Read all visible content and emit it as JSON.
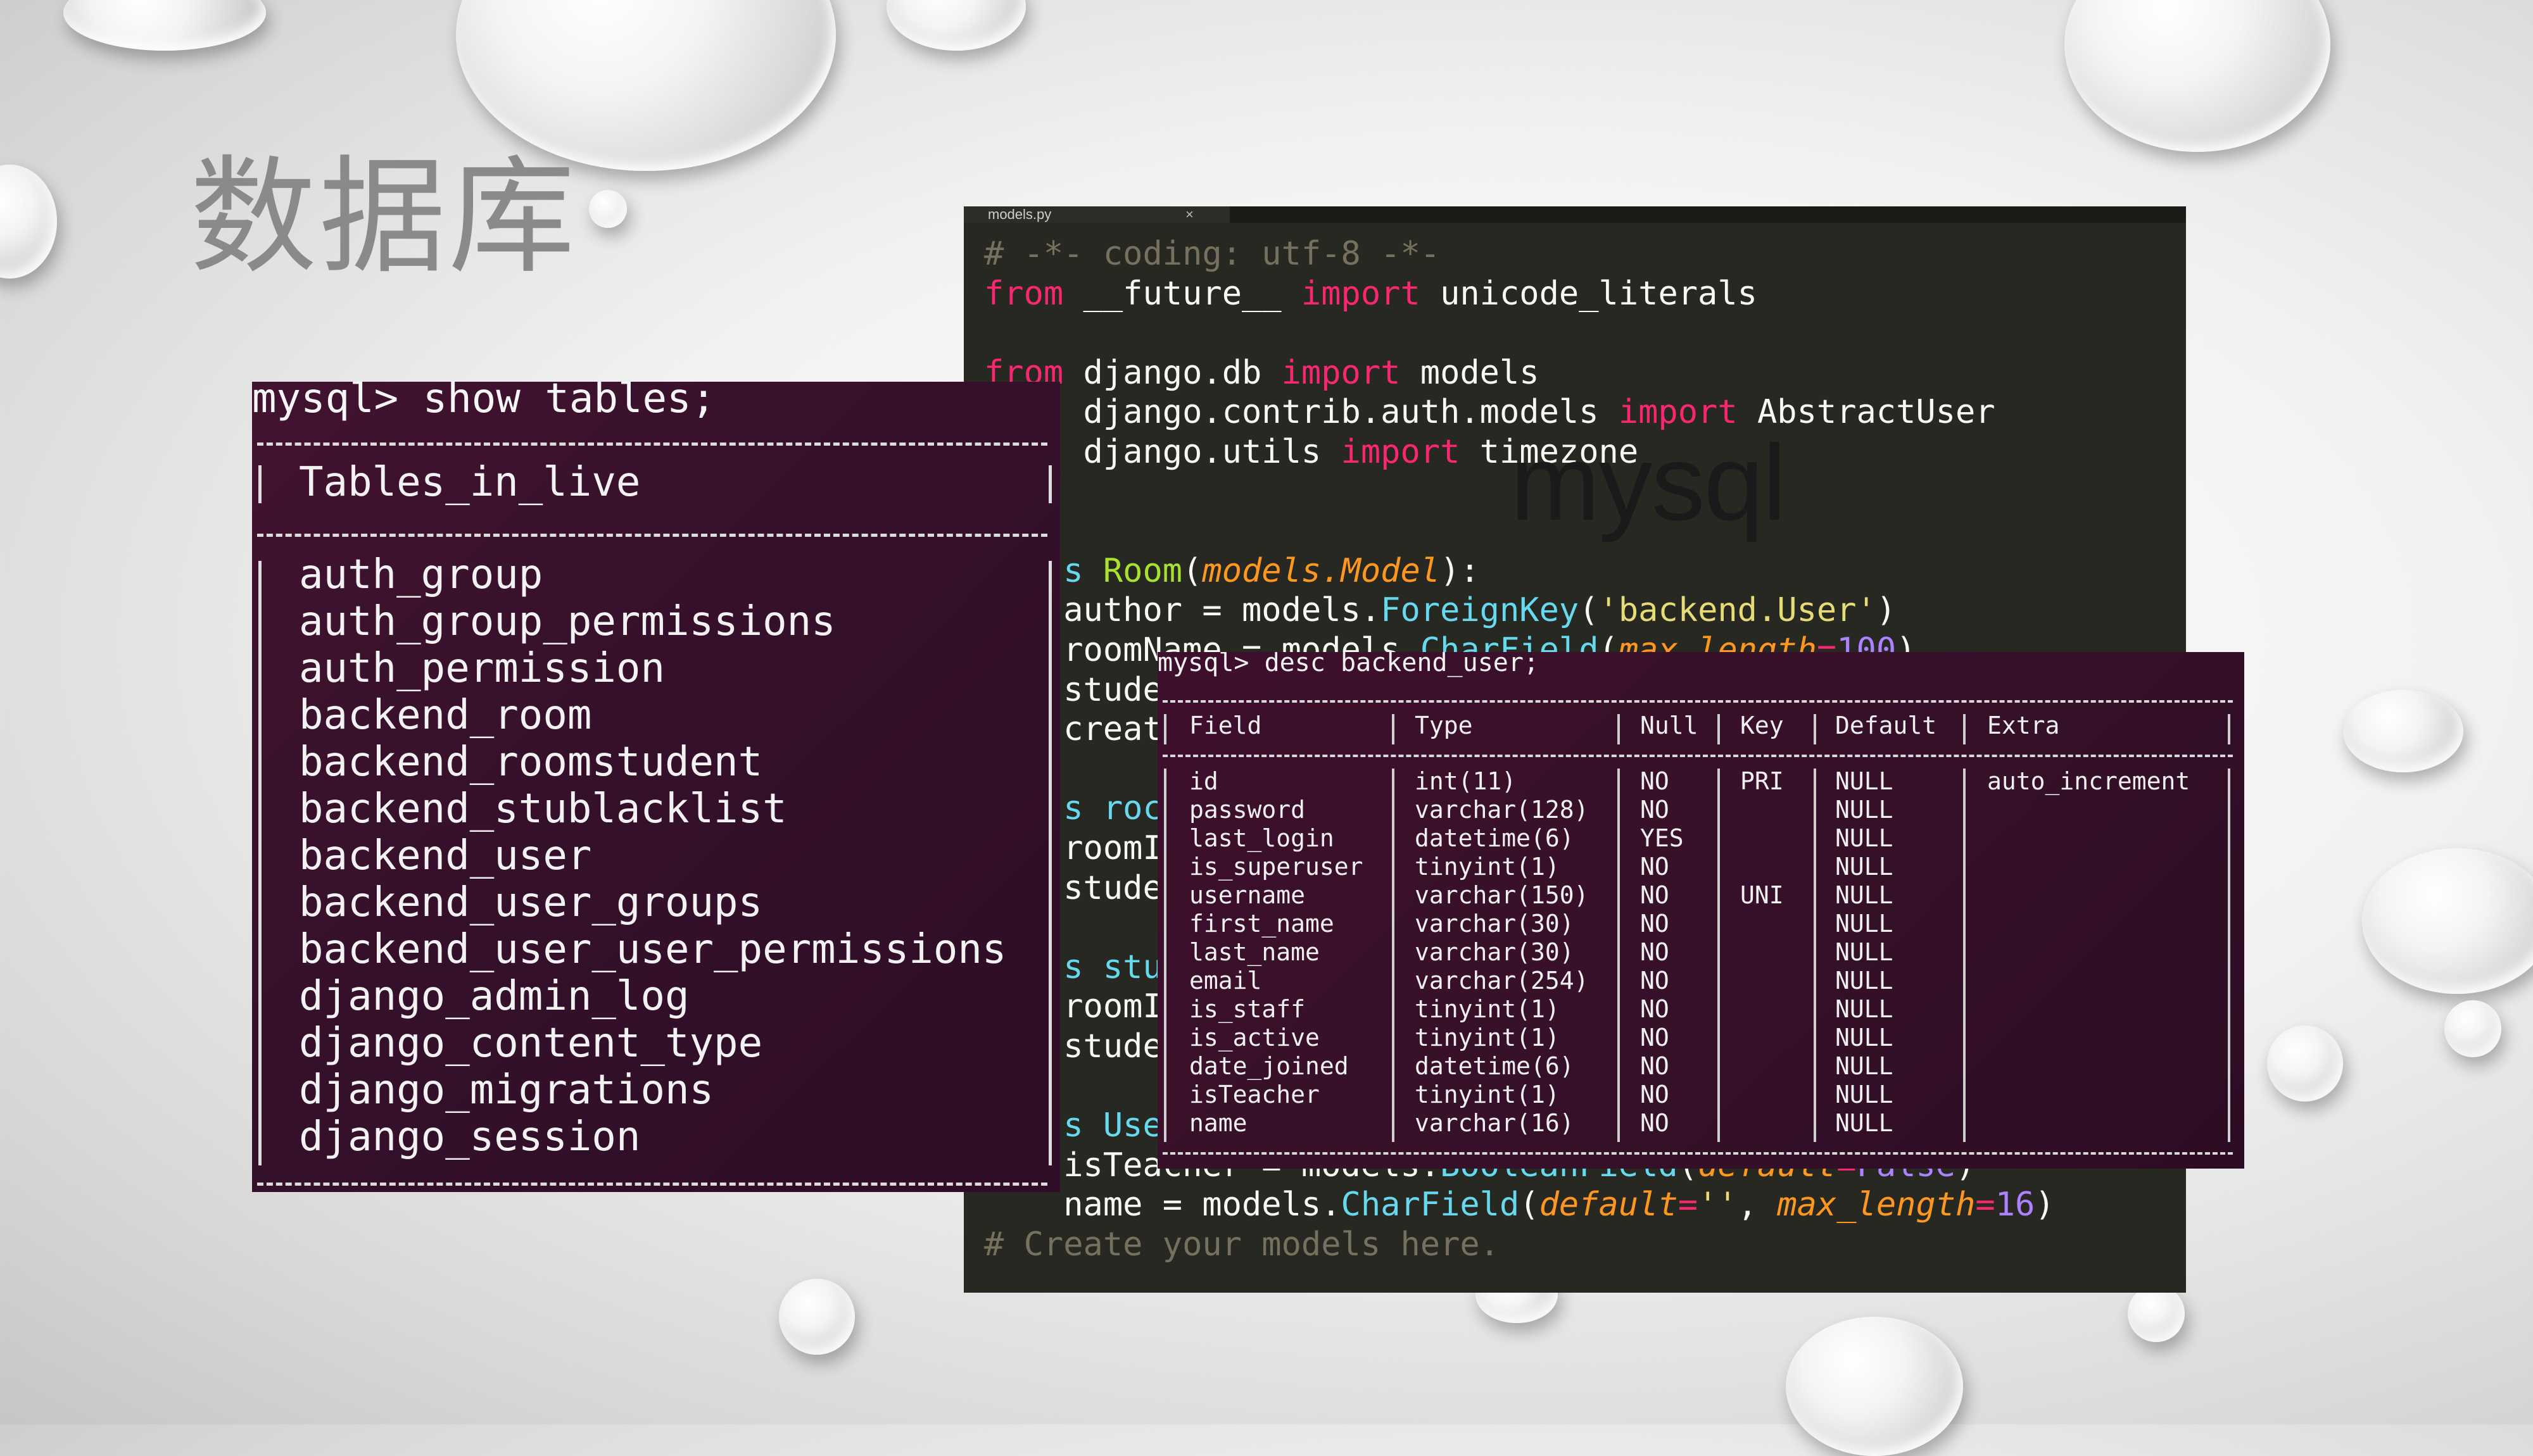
{
  "slide": {
    "title": "数据库"
  },
  "overlay_label": "mysql",
  "editor": {
    "tab_name": "models.py",
    "tab_close": "×",
    "lines": [
      [
        {
          "t": "# -*- coding: utf-8 -*-",
          "c": "cm"
        }
      ],
      [
        {
          "t": "from",
          "c": "kw"
        },
        {
          "t": " __future__ ",
          "c": ""
        },
        {
          "t": "import",
          "c": "kw"
        },
        {
          "t": " unicode_literals",
          "c": ""
        }
      ],
      [
        {
          "t": "",
          "c": ""
        }
      ],
      [
        {
          "t": "from",
          "c": "kw"
        },
        {
          "t": " django.db ",
          "c": ""
        },
        {
          "t": "import",
          "c": "kw"
        },
        {
          "t": " models",
          "c": ""
        }
      ],
      [
        {
          "t": "     django.contrib.auth.models ",
          "c": ""
        },
        {
          "t": "import",
          "c": "kw"
        },
        {
          "t": " AbstractUser",
          "c": ""
        }
      ],
      [
        {
          "t": "     django.utils ",
          "c": ""
        },
        {
          "t": "import",
          "c": "kw"
        },
        {
          "t": " timezone",
          "c": ""
        }
      ],
      [
        {
          "t": "",
          "c": ""
        }
      ],
      [
        {
          "t": "",
          "c": ""
        }
      ],
      [
        {
          "t": "    s ",
          "c": "ty"
        },
        {
          "t": "Room",
          "c": "fn"
        },
        {
          "t": "(",
          "c": ""
        },
        {
          "t": "models.Model",
          "c": "fn pa"
        },
        {
          "t": "):",
          "c": ""
        }
      ],
      [
        {
          "t": "    author = models.",
          "c": ""
        },
        {
          "t": "ForeignKey",
          "c": "ty"
        },
        {
          "t": "(",
          "c": ""
        },
        {
          "t": "'backend.User'",
          "c": "st"
        },
        {
          "t": ")",
          "c": ""
        }
      ],
      [
        {
          "t": "    roomName = models.",
          "c": ""
        },
        {
          "t": "CharField",
          "c": "ty"
        },
        {
          "t": "(",
          "c": ""
        },
        {
          "t": "max_length",
          "c": "pa"
        },
        {
          "t": "=",
          "c": "kw"
        },
        {
          "t": "100",
          "c": "nm"
        },
        {
          "t": ")",
          "c": ""
        }
      ],
      [
        {
          "t": "    stude",
          "c": ""
        }
      ],
      [
        {
          "t": "    creat",
          "c": ""
        }
      ],
      [
        {
          "t": "",
          "c": ""
        }
      ],
      [
        {
          "t": "    s roc",
          "c": "ty"
        }
      ],
      [
        {
          "t": "    roomI",
          "c": ""
        }
      ],
      [
        {
          "t": "    stude",
          "c": ""
        }
      ],
      [
        {
          "t": "",
          "c": ""
        }
      ],
      [
        {
          "t": "    s stu",
          "c": "ty"
        }
      ],
      [
        {
          "t": "    roomI",
          "c": ""
        }
      ],
      [
        {
          "t": "    stude",
          "c": ""
        }
      ],
      [
        {
          "t": "",
          "c": ""
        }
      ],
      [
        {
          "t": "    s Use",
          "c": "ty"
        }
      ],
      [
        {
          "t": "    isTeacher = models.",
          "c": ""
        },
        {
          "t": "BooleanField",
          "c": "ty"
        },
        {
          "t": "(",
          "c": ""
        },
        {
          "t": "default",
          "c": "pa"
        },
        {
          "t": "=",
          "c": "kw"
        },
        {
          "t": "False",
          "c": "nm"
        },
        {
          "t": ")",
          "c": ""
        }
      ],
      [
        {
          "t": "    name = models.",
          "c": ""
        },
        {
          "t": "CharField",
          "c": "ty"
        },
        {
          "t": "(",
          "c": ""
        },
        {
          "t": "default",
          "c": "pa"
        },
        {
          "t": "=",
          "c": "kw"
        },
        {
          "t": "''",
          "c": "st"
        },
        {
          "t": ", ",
          "c": ""
        },
        {
          "t": "max_length",
          "c": "pa"
        },
        {
          "t": "=",
          "c": "kw"
        },
        {
          "t": "16",
          "c": "nm"
        },
        {
          "t": ")",
          "c": ""
        }
      ],
      [
        {
          "t": "# Create your models here.",
          "c": "cm"
        }
      ]
    ]
  },
  "terminal_tables": {
    "prompt": "mysql> show tables;",
    "header": "Tables_in_live",
    "rows": [
      "auth_group",
      "auth_group_permissions",
      "auth_permission",
      "backend_room",
      "backend_roomstudent",
      "backend_stublacklist",
      "backend_user",
      "backend_user_groups",
      "backend_user_user_permissions",
      "django_admin_log",
      "django_content_type",
      "django_migrations",
      "django_session"
    ]
  },
  "terminal_desc": {
    "prompt": "mysql> desc backend_user;",
    "columns": [
      "Field",
      "Type",
      "Null",
      "Key",
      "Default",
      "Extra"
    ],
    "rows": [
      [
        "id",
        "int(11)",
        "NO",
        "PRI",
        "NULL",
        "auto_increment"
      ],
      [
        "password",
        "varchar(128)",
        "NO",
        "",
        "NULL",
        ""
      ],
      [
        "last_login",
        "datetime(6)",
        "YES",
        "",
        "NULL",
        ""
      ],
      [
        "is_superuser",
        "tinyint(1)",
        "NO",
        "",
        "NULL",
        ""
      ],
      [
        "username",
        "varchar(150)",
        "NO",
        "UNI",
        "NULL",
        ""
      ],
      [
        "first_name",
        "varchar(30)",
        "NO",
        "",
        "NULL",
        ""
      ],
      [
        "last_name",
        "varchar(30)",
        "NO",
        "",
        "NULL",
        ""
      ],
      [
        "email",
        "varchar(254)",
        "NO",
        "",
        "NULL",
        ""
      ],
      [
        "is_staff",
        "tinyint(1)",
        "NO",
        "",
        "NULL",
        ""
      ],
      [
        "is_active",
        "tinyint(1)",
        "NO",
        "",
        "NULL",
        ""
      ],
      [
        "date_joined",
        "datetime(6)",
        "NO",
        "",
        "NULL",
        ""
      ],
      [
        "isTeacher",
        "tinyint(1)",
        "NO",
        "",
        "NULL",
        ""
      ],
      [
        "name",
        "varchar(16)",
        "NO",
        "",
        "NULL",
        ""
      ]
    ]
  }
}
